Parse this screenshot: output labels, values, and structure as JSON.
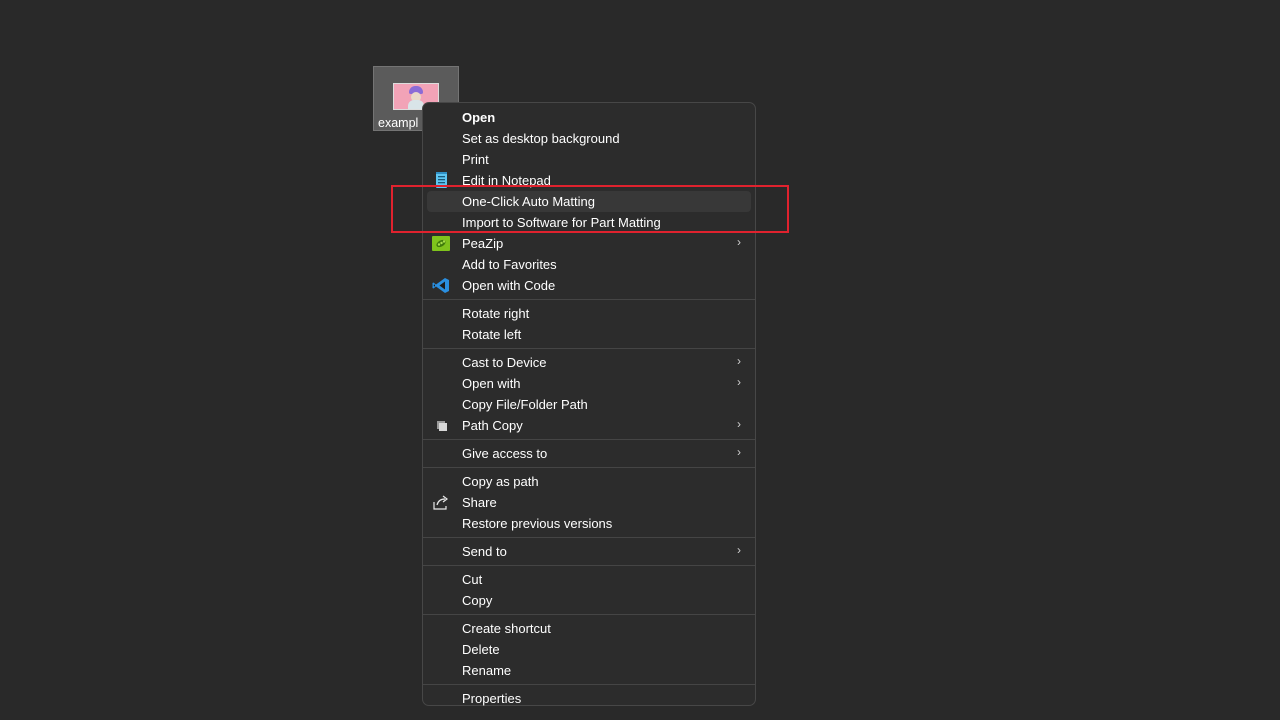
{
  "file": {
    "name": "exampl"
  },
  "menu": {
    "items": [
      {
        "label": "Open"
      },
      {
        "label": "Set as desktop background"
      },
      {
        "label": "Print"
      },
      {
        "label": "Edit in Notepad"
      },
      {
        "label": "One-Click Auto Matting"
      },
      {
        "label": "Import to Software for Part Matting"
      },
      {
        "label": "PeaZip"
      },
      {
        "label": "Add to Favorites"
      },
      {
        "label": "Open with Code"
      },
      {
        "label": "Rotate right"
      },
      {
        "label": "Rotate left"
      },
      {
        "label": "Cast to Device"
      },
      {
        "label": "Open with"
      },
      {
        "label": "Copy File/Folder Path"
      },
      {
        "label": "Path Copy"
      },
      {
        "label": "Give access to"
      },
      {
        "label": "Copy as path"
      },
      {
        "label": "Share"
      },
      {
        "label": "Restore previous versions"
      },
      {
        "label": "Send to"
      },
      {
        "label": "Cut"
      },
      {
        "label": "Copy"
      },
      {
        "label": "Create shortcut"
      },
      {
        "label": "Delete"
      },
      {
        "label": "Rename"
      },
      {
        "label": "Properties"
      }
    ],
    "chevron": "›"
  },
  "colors": {
    "background": "#292929",
    "menu": "#2c2c2c",
    "highlight_border": "#e0222e",
    "text": "#ffffff"
  },
  "icons": {
    "notepad": "notepad-icon",
    "peazip": "peazip-icon",
    "vscode": "vscode-icon",
    "path_copy": "path-copy-icon",
    "share": "share-icon"
  }
}
